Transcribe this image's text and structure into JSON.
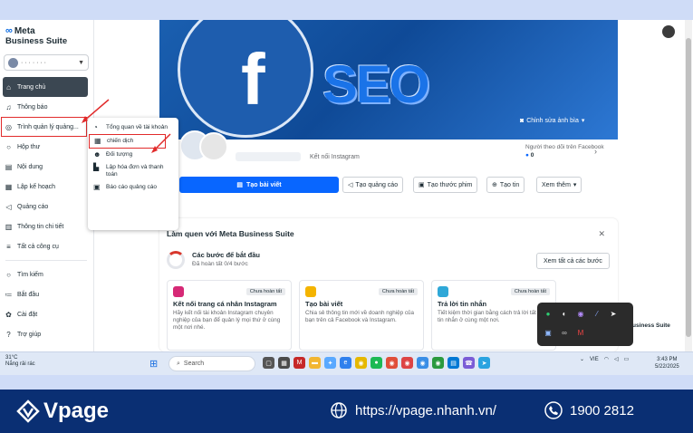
{
  "brand": {
    "line1": "Meta",
    "line2": "Business Suite",
    "account_name": "· · · · · · ·"
  },
  "nav": [
    {
      "id": "home",
      "label": "Trang chủ",
      "icon": "home-icon",
      "glyph": "⌂"
    },
    {
      "id": "notifications",
      "label": "Thông báo",
      "icon": "bell-icon",
      "glyph": "♫"
    },
    {
      "id": "ads-manager",
      "label": "Trình quản lý quảng...",
      "icon": "ads-manager-icon",
      "glyph": "◎"
    },
    {
      "id": "inbox",
      "label": "Hộp thư",
      "icon": "chat-icon",
      "glyph": "○"
    },
    {
      "id": "content",
      "label": "Nội dung",
      "icon": "content-icon",
      "glyph": "▤"
    },
    {
      "id": "planner",
      "label": "Lập kế hoạch",
      "icon": "calendar-icon",
      "glyph": "▦"
    },
    {
      "id": "ads",
      "label": "Quảng cáo",
      "icon": "megaphone-icon",
      "glyph": "◁"
    },
    {
      "id": "insights",
      "label": "Thông tin chi tiết",
      "icon": "chart-icon",
      "glyph": "▥"
    },
    {
      "id": "all-tools",
      "label": "Tất cả công cụ",
      "icon": "menu-icon",
      "glyph": "≡"
    }
  ],
  "nav_bottom": [
    {
      "id": "search",
      "label": "Tìm kiếm",
      "icon": "search-icon",
      "glyph": "○"
    },
    {
      "id": "start",
      "label": "Bắt đầu",
      "icon": "list-icon",
      "glyph": "≔"
    },
    {
      "id": "settings",
      "label": "Cài đặt",
      "icon": "gear-icon",
      "glyph": "✿"
    },
    {
      "id": "help",
      "label": "Trợ giúp",
      "icon": "help-icon",
      "glyph": "?"
    }
  ],
  "dropdown": [
    {
      "label": "Tổng quan về tài khoản",
      "icon": "overview-icon",
      "glyph": "◔"
    },
    {
      "label": "chiến dịch",
      "icon": "campaign-icon",
      "glyph": "▦"
    },
    {
      "label": "Đối tượng",
      "icon": "audience-icon",
      "glyph": "☻"
    },
    {
      "label": "Lập hóa đơn và thanh toán",
      "icon": "billing-icon",
      "glyph": "▙"
    },
    {
      "label": "Báo cáo quảng cáo",
      "icon": "report-icon",
      "glyph": "▣"
    }
  ],
  "cover": {
    "edit_label": "Chỉnh sửa ảnh bìa",
    "text_f": "f",
    "text_seo": "SEO"
  },
  "profile": {
    "connect_instagram": "Kết nối Instagram",
    "followers_label": "Người theo dõi trên Facebook",
    "followers_count": "0"
  },
  "actions": {
    "create_post": "Tạo bài viết",
    "create_ad": "Tạo quảng cáo",
    "create_reel": "Tạo thước phim",
    "create_story": "Tạo tin",
    "more": "Xem thêm"
  },
  "getting_started": {
    "title": "Làm quen với Meta Business Suite",
    "subtitle": "Các bước để bắt đầu",
    "progress": "Đã hoàn tất 0/4 bước",
    "progress_fraction": 0,
    "see_all": "Xem tất cả các bước",
    "steps": [
      {
        "title": "Kết nối trang cá nhân Instagram",
        "badge": "Chưa hoàn tất",
        "desc": "Hãy kết nối tài khoản Instagram chuyên nghiệp của bạn để quản lý mọi thứ ở cùng một nơi nhé.",
        "color": "#d62976"
      },
      {
        "title": "Tạo bài viết",
        "badge": "Chưa hoàn tất",
        "desc": "Chia sẻ thông tin mới về doanh nghiệp của bạn trên cả Facebook và Instagram.",
        "color": "#f4b400"
      },
      {
        "title": "Trả lời tin nhắn",
        "badge": "Chưa hoàn tất",
        "desc": "Tiết kiệm thời gian bằng cách trả lời tất cả tin nhắn ở cùng một nơi.",
        "color": "#2fa8d8"
      }
    ]
  },
  "side_note": "usiness Suite",
  "taskbar": {
    "weather_temp": "31°C",
    "weather_desc": "Nắng rải rác",
    "search": "Search",
    "lang": "VIE",
    "time": "3:43 PM",
    "date": "5/22/2025"
  },
  "footer": {
    "brand": "Vpage",
    "url": "https://vpage.nhanh.vn/",
    "phone": "1900 2812"
  },
  "colors": {
    "primary": "#0866ff",
    "highlight": "#e12b2b",
    "footer_bg": "#0a2f73",
    "active_nav": "#3b4752"
  }
}
